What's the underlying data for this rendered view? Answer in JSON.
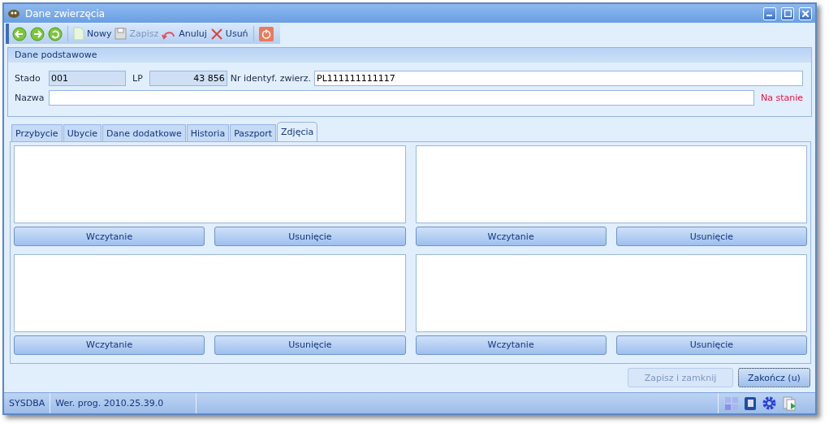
{
  "window": {
    "title": "Dane zwierzęcia"
  },
  "toolbar": [
    {
      "kind": "back"
    },
    {
      "kind": "forward"
    },
    {
      "kind": "refresh"
    },
    {
      "kind": "new",
      "label": "Nowy",
      "disabled": false
    },
    {
      "kind": "save",
      "label": "Zapisz",
      "disabled": true
    },
    {
      "kind": "cancel",
      "label": "Anuluj",
      "disabled": false
    },
    {
      "kind": "delete",
      "label": "Usuń",
      "disabled": false
    },
    {
      "kind": "power"
    }
  ],
  "basic": {
    "title": "Dane podstawowe",
    "herd_label": "Stado",
    "herd": "001",
    "lp_label": "LP",
    "lp": "43 856",
    "id_label": "Nr identyf. zwierz.",
    "id": "PL111111111117",
    "name_label": "Nazwa",
    "status": "Na stanie"
  },
  "tabs": [
    {
      "label": "Przybycie",
      "selected": false
    },
    {
      "label": "Ubycie",
      "selected": false
    },
    {
      "label": "Dane dodatkowe",
      "selected": false
    },
    {
      "label": "Historia",
      "selected": false
    },
    {
      "label": "Paszport",
      "selected": false
    },
    {
      "label": "Zdjęcia",
      "selected": true
    }
  ],
  "photos": [
    {
      "load": "Wczytanie",
      "remove": "Usunięcie"
    },
    {
      "load": "Wczytanie",
      "remove": "Usunięcie"
    },
    {
      "load": "Wczytanie",
      "remove": "Usunięcie"
    },
    {
      "load": "Wczytanie",
      "remove": "Usunięcie"
    }
  ],
  "buttons": [
    {
      "label": "Zapisz i zamknij",
      "disabled": true
    },
    {
      "label": "Zakończ (u)",
      "disabled": false
    }
  ],
  "status_bar": {
    "user": "SYSDBA",
    "version": "Wer. prog. 2010.25.39.0"
  }
}
